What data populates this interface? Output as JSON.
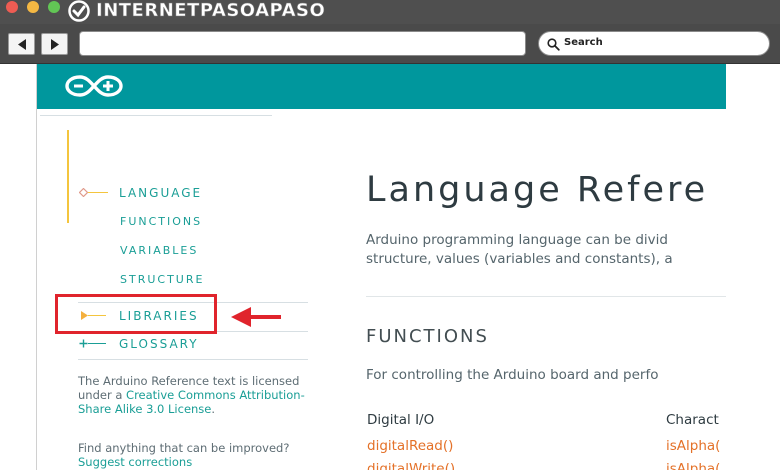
{
  "browser": {
    "watermark": {
      "part1": "INTERNET",
      "part2": "PASO",
      "part3": "A",
      "part4": "PASO"
    },
    "search_placeholder": "Search",
    "icons": {
      "back": "arrow-left-icon",
      "forward": "arrow-right-icon",
      "search": "search-icon"
    }
  },
  "colors": {
    "header": "#00979d",
    "nav_text": "#1a9e96",
    "link_orange": "#e47128",
    "highlight": "#e0242c",
    "tree_line": "#f4c53e"
  },
  "sidebar": {
    "items": [
      {
        "label": "LANGUAGE"
      },
      {
        "label": "FUNCTIONS"
      },
      {
        "label": "VARIABLES"
      },
      {
        "label": "STRUCTURE"
      },
      {
        "label": "LIBRARIES"
      },
      {
        "label": "GLOSSARY"
      }
    ],
    "license": {
      "prefix": "The Arduino Reference text is licensed under a ",
      "link": "Creative Commons Attribution-Share Alike 3.0 License",
      "suffix": "."
    },
    "find": {
      "prefix": "Find anything that can be improved? ",
      "link": "Suggest corrections"
    }
  },
  "main": {
    "title": "Language Refere",
    "desc_line1": "Arduino programming language can be divid",
    "desc_line2": "structure, values (variables and constants), a",
    "section_title": "FUNCTIONS",
    "section_desc": "For controlling the Arduino board and perfo",
    "columns": [
      {
        "heading": "Digital I/O",
        "links": [
          "digitalRead()",
          "digitalWrite()"
        ]
      },
      {
        "heading": "Charact",
        "links": [
          "isAlpha(",
          "isAlpha("
        ]
      }
    ]
  }
}
